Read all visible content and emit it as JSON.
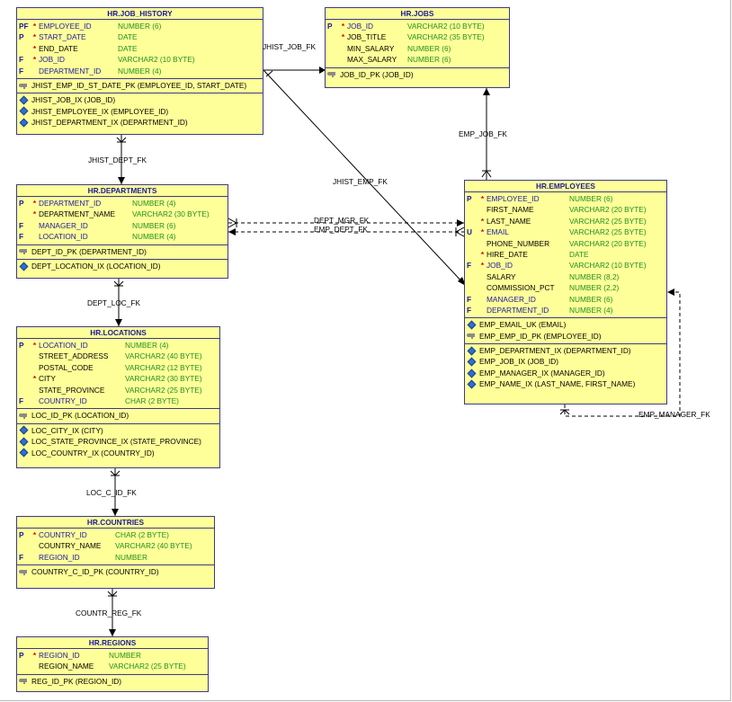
{
  "tables": {
    "job_history": {
      "title": "HR.JOB_HISTORY",
      "columns": [
        {
          "flag": "PF",
          "req": "*",
          "name": "EMPLOYEE_ID",
          "type": "NUMBER (6)"
        },
        {
          "flag": "P",
          "req": "*",
          "name": "START_DATE",
          "type": "DATE"
        },
        {
          "flag": "",
          "req": "*",
          "name": "END_DATE",
          "type": "DATE"
        },
        {
          "flag": "F",
          "req": "*",
          "name": "JOB_ID",
          "type": "VARCHAR2 (10 BYTE)"
        },
        {
          "flag": "F",
          "req": "",
          "name": "DEPARTMENT_ID",
          "type": "NUMBER (4)"
        }
      ],
      "keys": [
        "JHIST_EMP_ID_ST_DATE_PK (EMPLOYEE_ID, START_DATE)"
      ],
      "indexes": [
        "JHIST_JOB_IX (JOB_ID)",
        "JHIST_EMPLOYEE_IX (EMPLOYEE_ID)",
        "JHIST_DEPARTMENT_IX (DEPARTMENT_ID)"
      ]
    },
    "jobs": {
      "title": "HR.JOBS",
      "columns": [
        {
          "flag": "P",
          "req": "*",
          "name": "JOB_ID",
          "type": "VARCHAR2 (10 BYTE)"
        },
        {
          "flag": "",
          "req": "*",
          "name": "JOB_TITLE",
          "type": "VARCHAR2 (35 BYTE)"
        },
        {
          "flag": "",
          "req": "",
          "name": "MIN_SALARY",
          "type": "NUMBER (6)"
        },
        {
          "flag": "",
          "req": "",
          "name": "MAX_SALARY",
          "type": "NUMBER (6)"
        }
      ],
      "keys": [
        "JOB_ID_PK (JOB_ID)"
      ],
      "indexes": []
    },
    "departments": {
      "title": "HR.DEPARTMENTS",
      "columns": [
        {
          "flag": "P",
          "req": "*",
          "name": "DEPARTMENT_ID",
          "type": "NUMBER (4)"
        },
        {
          "flag": "",
          "req": "*",
          "name": "DEPARTMENT_NAME",
          "type": "VARCHAR2 (30 BYTE)"
        },
        {
          "flag": "F",
          "req": "",
          "name": "MANAGER_ID",
          "type": "NUMBER (6)"
        },
        {
          "flag": "F",
          "req": "",
          "name": "LOCATION_ID",
          "type": "NUMBER (4)"
        }
      ],
      "keys": [
        "DEPT_ID_PK (DEPARTMENT_ID)"
      ],
      "indexes": [
        "DEPT_LOCATION_IX (LOCATION_ID)"
      ]
    },
    "employees": {
      "title": "HR.EMPLOYEES",
      "columns": [
        {
          "flag": "P",
          "req": "*",
          "name": "EMPLOYEE_ID",
          "type": "NUMBER (6)"
        },
        {
          "flag": "",
          "req": "",
          "name": "FIRST_NAME",
          "type": "VARCHAR2 (20 BYTE)"
        },
        {
          "flag": "",
          "req": "*",
          "name": "LAST_NAME",
          "type": "VARCHAR2 (25 BYTE)"
        },
        {
          "flag": "U",
          "req": "*",
          "name": "EMAIL",
          "type": "VARCHAR2 (25 BYTE)"
        },
        {
          "flag": "",
          "req": "",
          "name": "PHONE_NUMBER",
          "type": "VARCHAR2 (20 BYTE)"
        },
        {
          "flag": "",
          "req": "*",
          "name": "HIRE_DATE",
          "type": "DATE"
        },
        {
          "flag": "F",
          "req": "*",
          "name": "JOB_ID",
          "type": "VARCHAR2 (10 BYTE)"
        },
        {
          "flag": "",
          "req": "",
          "name": "SALARY",
          "type": "NUMBER (8,2)"
        },
        {
          "flag": "",
          "req": "",
          "name": "COMMISSION_PCT",
          "type": "NUMBER (2,2)"
        },
        {
          "flag": "F",
          "req": "",
          "name": "MANAGER_ID",
          "type": "NUMBER (6)"
        },
        {
          "flag": "F",
          "req": "",
          "name": "DEPARTMENT_ID",
          "type": "NUMBER (4)"
        }
      ],
      "keys_uk": [
        "EMP_EMAIL_UK (EMAIL)"
      ],
      "keys": [
        "EMP_EMP_ID_PK (EMPLOYEE_ID)"
      ],
      "indexes": [
        "EMP_DEPARTMENT_IX (DEPARTMENT_ID)",
        "EMP_JOB_IX (JOB_ID)",
        "EMP_MANAGER_IX (MANAGER_ID)",
        "EMP_NAME_IX (LAST_NAME, FIRST_NAME)"
      ]
    },
    "locations": {
      "title": "HR.LOCATIONS",
      "columns": [
        {
          "flag": "P",
          "req": "*",
          "name": "LOCATION_ID",
          "type": "NUMBER (4)"
        },
        {
          "flag": "",
          "req": "",
          "name": "STREET_ADDRESS",
          "type": "VARCHAR2 (40 BYTE)"
        },
        {
          "flag": "",
          "req": "",
          "name": "POSTAL_CODE",
          "type": "VARCHAR2 (12 BYTE)"
        },
        {
          "flag": "",
          "req": "*",
          "name": "CITY",
          "type": "VARCHAR2 (30 BYTE)"
        },
        {
          "flag": "",
          "req": "",
          "name": "STATE_PROVINCE",
          "type": "VARCHAR2 (25 BYTE)"
        },
        {
          "flag": "F",
          "req": "",
          "name": "COUNTRY_ID",
          "type": "CHAR (2 BYTE)"
        }
      ],
      "keys": [
        "LOC_ID_PK (LOCATION_ID)"
      ],
      "indexes": [
        "LOC_CITY_IX (CITY)",
        "LOC_STATE_PROVINCE_IX (STATE_PROVINCE)",
        "LOC_COUNTRY_IX (COUNTRY_ID)"
      ]
    },
    "countries": {
      "title": "HR.COUNTRIES",
      "columns": [
        {
          "flag": "P",
          "req": "*",
          "name": "COUNTRY_ID",
          "type": "CHAR (2 BYTE)"
        },
        {
          "flag": "",
          "req": "",
          "name": "COUNTRY_NAME",
          "type": "VARCHAR2 (40 BYTE)"
        },
        {
          "flag": "F",
          "req": "",
          "name": "REGION_ID",
          "type": "NUMBER"
        }
      ],
      "keys": [
        "COUNTRY_C_ID_PK (COUNTRY_ID)"
      ],
      "indexes": []
    },
    "regions": {
      "title": "HR.REGIONS",
      "columns": [
        {
          "flag": "P",
          "req": "*",
          "name": "REGION_ID",
          "type": "NUMBER"
        },
        {
          "flag": "",
          "req": "",
          "name": "REGION_NAME",
          "type": "VARCHAR2 (25 BYTE)"
        }
      ],
      "keys": [
        "REG_ID_PK (REGION_ID)"
      ],
      "indexes": []
    }
  },
  "relations": {
    "jhist_job_fk": "JHIST_JOB_FK",
    "jhist_dept_fk": "JHIST_DEPT_FK",
    "jhist_emp_fk": "JHIST_EMP_FK",
    "emp_job_fk": "EMP_JOB_FK",
    "dept_mgr_fk": "DEPT_MGR_FK",
    "emp_dept_fk": "EMP_DEPT_FK",
    "dept_loc_fk": "DEPT_LOC_FK",
    "loc_c_id_fk": "LOC_C_ID_FK",
    "countr_reg_fk": "COUNTR_REG_FK",
    "emp_manager_fk": "EMP_MANAGER_FK"
  },
  "colors": {
    "table_fill": "#ffff99",
    "table_border": "#3a3a8c",
    "key_text": "#1a1aa0",
    "type_text": "#209020",
    "required_marker": "#e00000"
  }
}
